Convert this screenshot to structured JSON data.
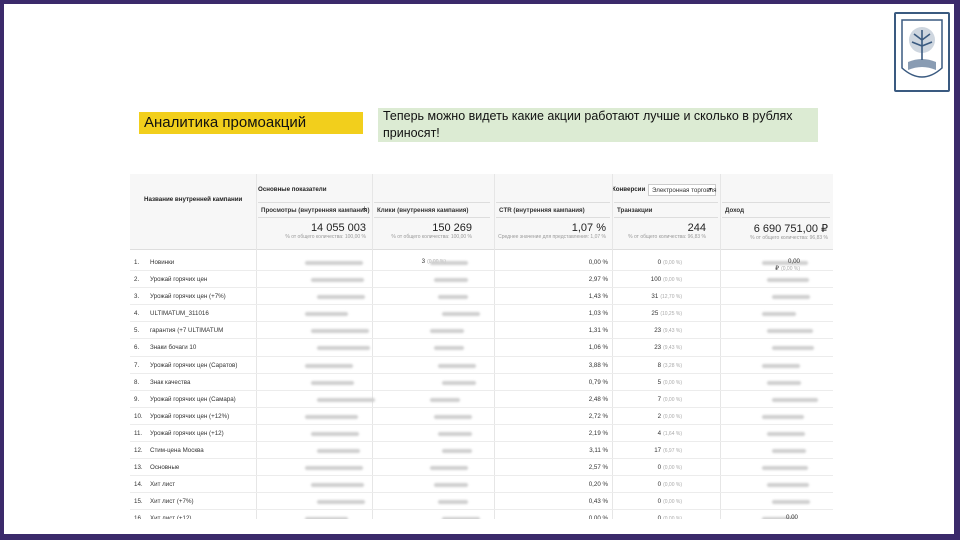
{
  "slide": {
    "title": "Аналитика промоакций",
    "description": "Теперь можно видеть какие акции работают лучше и сколько в рублях приносят!"
  },
  "report": {
    "dimension_header": "Название внутренней кампании",
    "group_header": "Основные показатели",
    "conversions_label": "Конверсии",
    "conversions_selected": "Электронная торговля",
    "columns": [
      "Просмотры (внутренняя кампания)",
      "Клики (внутренняя кампания)",
      "CTR (внутренняя кампания)",
      "Транзакции",
      "Доход"
    ],
    "totals": [
      {
        "value": "14 055 003",
        "sub": "% от общего количества: 100,00 %"
      },
      {
        "value": "150 269",
        "sub": "% от общего количества: 100,00 %"
      },
      {
        "value": "1,07 %",
        "sub": "Среднее значение для представления: 1,07 %"
      },
      {
        "value": "244",
        "sub": "% от общего количества: 96,83 %"
      },
      {
        "value": "6 690 751,00 ₽",
        "sub": "% от общего количества: 96,83 %"
      }
    ],
    "rows": [
      {
        "num": "1.",
        "name": "Новинки",
        "clicks": "3",
        "clicks_pct": "(0,00 %)",
        "ctr": "0,00 %",
        "trans": "0",
        "trans_pct": "(0,00 %)",
        "rev": "0,00 ₽",
        "rev_pct": "(0,00 %)"
      },
      {
        "num": "2.",
        "name": "Урожай горячих цен",
        "clicks": "",
        "clicks_pct": "",
        "ctr": "2,97 %",
        "trans": "100",
        "trans_pct": "(0,00 %)",
        "rev": "",
        "rev_pct": ""
      },
      {
        "num": "3.",
        "name": "Урожай горячих цен (+7%)",
        "clicks": "",
        "clicks_pct": "",
        "ctr": "1,43 %",
        "trans": "31",
        "trans_pct": "(12,70 %)",
        "rev": "",
        "rev_pct": ""
      },
      {
        "num": "4.",
        "name": "ULTIMATUM_311016",
        "clicks": "",
        "clicks_pct": "",
        "ctr": "1,03 %",
        "trans": "25",
        "trans_pct": "(10,25 %)",
        "rev": "",
        "rev_pct": ""
      },
      {
        "num": "5.",
        "name": "гарантия (+7 ULTIMATUM",
        "clicks": "",
        "clicks_pct": "",
        "ctr": "1,31 %",
        "trans": "23",
        "trans_pct": "(9,43 %)",
        "rev": "",
        "rev_pct": ""
      },
      {
        "num": "6.",
        "name": "Знаки бочаги 10",
        "clicks": "",
        "clicks_pct": "",
        "ctr": "1,06 %",
        "trans": "23",
        "trans_pct": "(9,43 %)",
        "rev": "",
        "rev_pct": ""
      },
      {
        "num": "7.",
        "name": "Урожай горячих цен (Саратов)",
        "clicks": "",
        "clicks_pct": "",
        "ctr": "3,88 %",
        "trans": "8",
        "trans_pct": "(3,28 %)",
        "rev": "",
        "rev_pct": ""
      },
      {
        "num": "8.",
        "name": "Знак качества",
        "clicks": "",
        "clicks_pct": "",
        "ctr": "0,79 %",
        "trans": "5",
        "trans_pct": "(0,00 %)",
        "rev": "",
        "rev_pct": ""
      },
      {
        "num": "9.",
        "name": "Урожай горячих цен (Самара)",
        "clicks": "",
        "clicks_pct": "",
        "ctr": "2,48 %",
        "trans": "7",
        "trans_pct": "(0,00 %)",
        "rev": "",
        "rev_pct": ""
      },
      {
        "num": "10.",
        "name": "Урожай горячих цен (+12%)",
        "clicks": "",
        "clicks_pct": "",
        "ctr": "2,72 %",
        "trans": "2",
        "trans_pct": "(0,00 %)",
        "rev": "",
        "rev_pct": ""
      },
      {
        "num": "11.",
        "name": "Урожай горячих цен (+12)",
        "clicks": "",
        "clicks_pct": "",
        "ctr": "2,19 %",
        "trans": "4",
        "trans_pct": "(1,64 %)",
        "rev": "",
        "rev_pct": ""
      },
      {
        "num": "12.",
        "name": "Стим-цена Москва",
        "clicks": "",
        "clicks_pct": "",
        "ctr": "3,11 %",
        "trans": "17",
        "trans_pct": "(6,97 %)",
        "rev": "",
        "rev_pct": ""
      },
      {
        "num": "13.",
        "name": "Основные",
        "clicks": "",
        "clicks_pct": "",
        "ctr": "2,57 %",
        "trans": "0",
        "trans_pct": "(0,00 %)",
        "rev": "",
        "rev_pct": ""
      },
      {
        "num": "14.",
        "name": "Хит лист",
        "clicks": "",
        "clicks_pct": "",
        "ctr": "0,20 %",
        "trans": "0",
        "trans_pct": "(0,00 %)",
        "rev": "",
        "rev_pct": ""
      },
      {
        "num": "15.",
        "name": "Хит лист (+7%)",
        "clicks": "",
        "clicks_pct": "",
        "ctr": "0,43 %",
        "trans": "0",
        "trans_pct": "(0,00 %)",
        "rev": "",
        "rev_pct": ""
      },
      {
        "num": "16.",
        "name": "Хит лист (+12)",
        "clicks": "",
        "clicks_pct": "",
        "ctr": "0,00 %",
        "trans": "0",
        "trans_pct": "(0,00 %)",
        "rev": "0,00",
        "rev_pct": ""
      }
    ]
  }
}
